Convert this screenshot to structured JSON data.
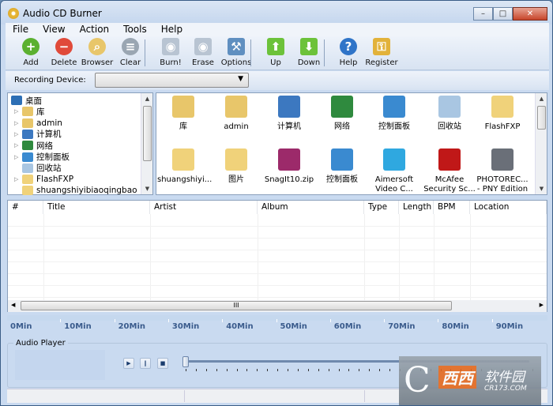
{
  "window": {
    "title": "Audio CD Burner",
    "controls": [
      "–",
      "□",
      "✕"
    ]
  },
  "menu": [
    "File",
    "View",
    "Action",
    "Tools",
    "Help"
  ],
  "toolbar": [
    {
      "label": "Add",
      "icon": "add-icon",
      "color": "#5bb030",
      "glyph": "+"
    },
    {
      "label": "Delete",
      "icon": "delete-icon",
      "color": "#e04a3a",
      "glyph": "−"
    },
    {
      "label": "Browser",
      "icon": "folder-search-icon",
      "color": "#e8c66a",
      "glyph": "⌕"
    },
    {
      "label": "Clear",
      "icon": "trash-icon",
      "color": "#9aa6b2",
      "glyph": "≡"
    },
    {
      "label": "Burn!",
      "icon": "burn-disc-icon",
      "color": "#b8c4d2",
      "glyph": "◉"
    },
    {
      "label": "Erase",
      "icon": "erase-disc-icon",
      "color": "#b8c4d2",
      "glyph": "◉"
    },
    {
      "label": "Options",
      "icon": "tools-icon",
      "color": "#5f8fc0",
      "glyph": "⚒"
    },
    {
      "label": "Up",
      "icon": "arrow-up-icon",
      "color": "#6cc23a",
      "glyph": "⬆"
    },
    {
      "label": "Down",
      "icon": "arrow-down-icon",
      "color": "#6cc23a",
      "glyph": "⬇"
    },
    {
      "label": "Help",
      "icon": "help-icon",
      "color": "#2f74c8",
      "glyph": "?"
    },
    {
      "label": "Register",
      "icon": "lock-icon",
      "color": "#e2b23a",
      "glyph": "⚿"
    }
  ],
  "recording": {
    "label": "Recording Device:",
    "value": ""
  },
  "tree": [
    {
      "label": "桌面",
      "icon": "desktop-icon",
      "color": "#2d6fb5",
      "expander": ""
    },
    {
      "label": "库",
      "icon": "library-icon",
      "color": "#e8c66a",
      "expander": "▷"
    },
    {
      "label": "admin",
      "icon": "user-folder-icon",
      "color": "#e8c66a",
      "expander": "▷"
    },
    {
      "label": "计算机",
      "icon": "computer-icon",
      "color": "#3c78c0",
      "expander": "▷"
    },
    {
      "label": "网络",
      "icon": "network-icon",
      "color": "#2f8a3e",
      "expander": "▷"
    },
    {
      "label": "控制面板",
      "icon": "control-panel-icon",
      "color": "#3a8ad0",
      "expander": "▷"
    },
    {
      "label": "回收站",
      "icon": "recycle-bin-icon",
      "color": "#a9c6e2",
      "expander": ""
    },
    {
      "label": "FlashFXP",
      "icon": "folder-icon",
      "color": "#f0d27a",
      "expander": "▷"
    },
    {
      "label": "shuangshiyibiaoqingbao",
      "icon": "folder-icon",
      "color": "#f0d27a",
      "expander": ""
    }
  ],
  "files": [
    {
      "label": "库",
      "icon": "library-icon",
      "color": "#e8c66a"
    },
    {
      "label": "admin",
      "icon": "user-folder-icon",
      "color": "#e8c66a"
    },
    {
      "label": "计算机",
      "icon": "computer-icon",
      "color": "#3c78c0"
    },
    {
      "label": "网络",
      "icon": "network-icon",
      "color": "#2f8a3e"
    },
    {
      "label": "控制面板",
      "icon": "control-panel-icon",
      "color": "#3a8ad0"
    },
    {
      "label": "回收站",
      "icon": "recycle-bin-icon",
      "color": "#a9c6e2"
    },
    {
      "label": "FlashFXP",
      "icon": "folder-icon",
      "color": "#f0d27a"
    },
    {
      "label": "shuangshiyi...",
      "icon": "folder-icon",
      "color": "#f0d27a"
    },
    {
      "label": "图片",
      "icon": "folder-icon",
      "color": "#f0d27a"
    },
    {
      "label": "SnagIt10.zip",
      "icon": "winrar-archive-icon",
      "color": "#9c2a6a"
    },
    {
      "label": "控制面板",
      "icon": "control-panel-icon",
      "color": "#3a8ad0"
    },
    {
      "label": "Aimersoft Video C...",
      "icon": "aimersoft-icon",
      "color": "#2fa8e0"
    },
    {
      "label": "McAfee Security Sc...",
      "icon": "mcafee-icon",
      "color": "#c01818"
    },
    {
      "label": "PHOTOREC... - PNY Edition",
      "icon": "photorec-icon",
      "color": "#6a6f78"
    }
  ],
  "columns": [
    "#",
    "Title",
    "Artist",
    "Album",
    "Type",
    "Length",
    "BPM",
    "Location"
  ],
  "capacity": [
    "0Min",
    "10Min",
    "20Min",
    "30Min",
    "40Min",
    "50Min",
    "60Min",
    "70Min",
    "80Min",
    "90Min"
  ],
  "player": {
    "label": "Audio Player",
    "play": "▶",
    "pause": "‖",
    "stop": "■",
    "position": 0
  },
  "watermark": {
    "brand": "西西",
    "text": "软件园",
    "site": "CR173.COM"
  }
}
